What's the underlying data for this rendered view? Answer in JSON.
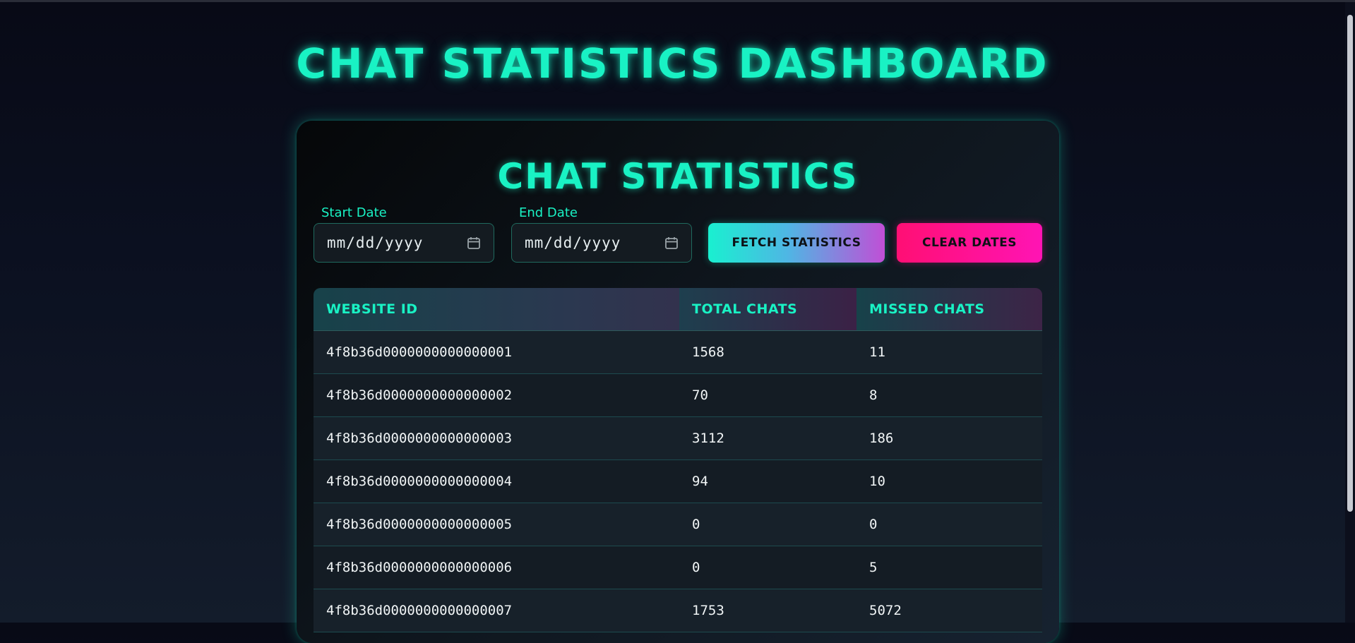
{
  "header": {
    "title": "CHAT STATISTICS DASHBOARD"
  },
  "card": {
    "title": "CHAT STATISTICS"
  },
  "filters": {
    "start_label": "Start Date",
    "start_placeholder": "mm/dd/yyyy",
    "end_label": "End Date",
    "end_placeholder": "mm/dd/yyyy",
    "fetch_label": "FETCH STATISTICS",
    "clear_label": "CLEAR DATES"
  },
  "table": {
    "headers": [
      "WEBSITE ID",
      "TOTAL CHATS",
      "MISSED CHATS"
    ],
    "rows": [
      [
        "4f8b36d0000000000000001",
        "1568",
        "11"
      ],
      [
        "4f8b36d0000000000000002",
        "70",
        "8"
      ],
      [
        "4f8b36d0000000000000003",
        "3112",
        "186"
      ],
      [
        "4f8b36d0000000000000004",
        "94",
        "10"
      ],
      [
        "4f8b36d0000000000000005",
        "0",
        "0"
      ],
      [
        "4f8b36d0000000000000006",
        "0",
        "5"
      ],
      [
        "4f8b36d0000000000000007",
        "1753",
        "5072"
      ]
    ]
  },
  "colors": {
    "accent": "#19f2c4",
    "fetch_gradient_start": "#19f0d0",
    "fetch_gradient_end": "#c04fd6",
    "clear_gradient_start": "#ff0f74",
    "clear_gradient_end": "#ff14b4"
  },
  "icons": {
    "date_picker": "calendar-icon"
  }
}
